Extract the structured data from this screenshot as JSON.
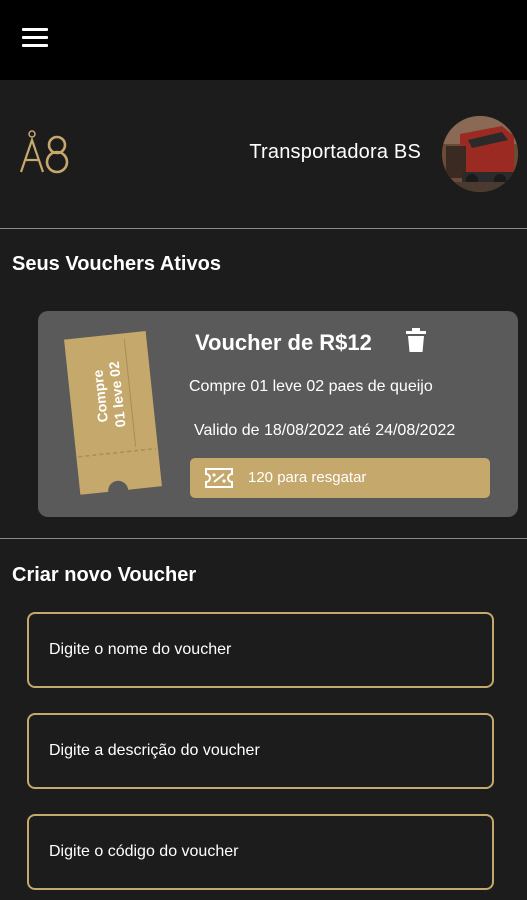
{
  "app": {
    "company_name": "Transportadora BS",
    "logo_text": "A8"
  },
  "active_section": {
    "title": "Seus Vouchers Ativos"
  },
  "voucher": {
    "ticket_text_line1": "Compre",
    "ticket_text_line2": "01 leve 02",
    "title": "Voucher de R$12",
    "description": "Compre 01 leve 02 paes de queijo",
    "validity": "Valido de 18/08/2022 até 24/08/2022",
    "redeem_label": "120 para resgatar"
  },
  "create_section": {
    "title": "Criar novo Voucher",
    "name_placeholder": "Digite o nome do voucher",
    "description_placeholder": "Digite a descrição do voucher",
    "code_placeholder": "Digite o código do voucher"
  },
  "colors": {
    "background": "#1c1c1c",
    "topbar": "#000000",
    "card": "#5a5a5a",
    "gold": "#c5a86b"
  }
}
